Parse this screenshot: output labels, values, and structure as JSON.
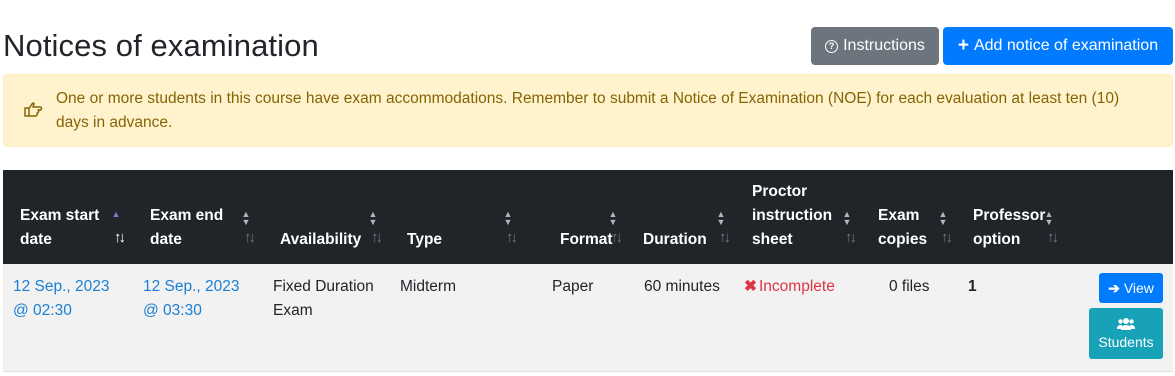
{
  "page": {
    "title": "Notices of examination"
  },
  "toolbar": {
    "instructions_label": "Instructions",
    "add_label": "Add notice of examination"
  },
  "alert": {
    "text": "One or more students in this course have exam accommodations. Remember to submit a Notice of Examination (NOE) for each evaluation at least ten (10) days in advance."
  },
  "table": {
    "headers": {
      "start": [
        "Exam start",
        "date"
      ],
      "end": [
        "Exam end",
        "date"
      ],
      "availability": "Availability",
      "type": "Type",
      "format": "Format",
      "duration": "Duration",
      "proctor": [
        "Proctor",
        "instruction",
        "sheet"
      ],
      "copies": [
        "Exam",
        "copies"
      ],
      "professor": [
        "Professor",
        "option"
      ]
    },
    "sorted_column": "Exam start date",
    "rows": [
      {
        "start_date": [
          "12 Sep., 2023",
          "@ 02:30"
        ],
        "end_date": [
          "12 Sep., 2023",
          "@ 03:30"
        ],
        "availability": [
          "Fixed Duration",
          "Exam"
        ],
        "type": "Midterm",
        "format": "Paper",
        "duration": "60 minutes",
        "proctor_status": "Incomplete",
        "copies": "0 files",
        "professor_option": "1",
        "view_label": "View",
        "students_label": "Students"
      }
    ]
  },
  "colors": {
    "primary": "#007bff",
    "secondary": "#6c757d",
    "info": "#17a2b8",
    "danger": "#dc3545",
    "warning_bg": "#fff3cd",
    "warning_text": "#856404",
    "header_bg": "#212529"
  },
  "icons": {
    "instructions": "question-circle-icon",
    "add": "plus-icon",
    "alert": "hand-pointing-right-icon",
    "incomplete": "x-icon",
    "view": "arrow-right-icon",
    "students": "users-icon"
  }
}
